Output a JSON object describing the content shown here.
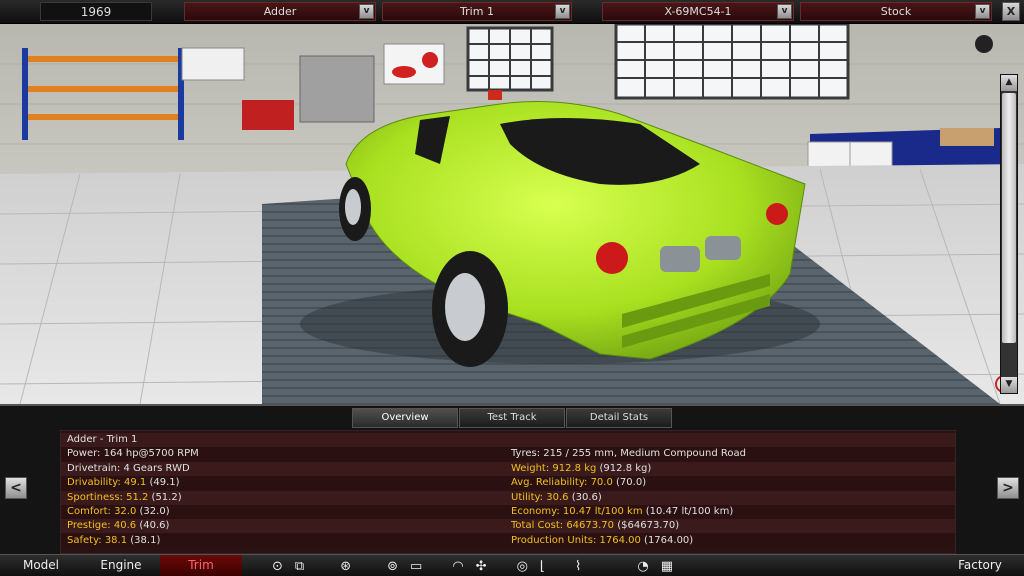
{
  "topbar": {
    "year": "1969",
    "model": "Adder",
    "trim": "Trim 1",
    "engine": "X-69MC54-1",
    "variant": "Stock",
    "dropdown_glyph": "v",
    "close_glyph": "X"
  },
  "tabs": [
    "Overview",
    "Test Track",
    "Detail Stats"
  ],
  "stats": {
    "left": [
      {
        "label": "Adder - Trim 1",
        "color": "white"
      },
      {
        "label": "Power: 164 hp@5700 RPM",
        "color": "white"
      },
      {
        "label": "Drivetrain: 4 Gears RWD",
        "color": "white"
      },
      {
        "label": "Drivability:",
        "value": " 49.1",
        "extra": " (49.1)",
        "color": "yellow"
      },
      {
        "label": "Sportiness:",
        "value": " 51.2",
        "extra": " (51.2)",
        "color": "yellow"
      },
      {
        "label": "Comfort:",
        "value": " 32.0",
        "extra": " (32.0)",
        "color": "yellow"
      },
      {
        "label": "Prestige:",
        "value": " 40.6",
        "extra": " (40.6)",
        "color": "yellow"
      },
      {
        "label": "Safety:",
        "value": " 38.1",
        "extra": " (38.1)",
        "color": "yellow"
      }
    ],
    "right": [
      {
        "label": "",
        "color": "white"
      },
      {
        "label": "Tyres: 215 / 255 mm, Medium Compound Road",
        "color": "white"
      },
      {
        "label": "Weight:",
        "value": " 912.8 kg",
        "extra": " (912.8 kg)",
        "color": "yellow"
      },
      {
        "label": "Avg. Reliability:",
        "value": " 70.0",
        "extra": " (70.0)",
        "color": "yellow"
      },
      {
        "label": "Utility:",
        "value": " 30.6",
        "extra": " (30.6)",
        "color": "yellow"
      },
      {
        "label": "Economy:",
        "value": " 10.47 lt/100 km",
        "extra": " (10.47 lt/100 km)",
        "color": "yellow"
      },
      {
        "label": "Total Cost:",
        "value": " 64673.70",
        "extra": " ($64673.70)",
        "color": "yellow"
      },
      {
        "label": "Production Units:",
        "value": " 1764.00",
        "extra": " (1764.00)",
        "color": "yellow"
      }
    ]
  },
  "side": {
    "prev": "<",
    "next": ">"
  },
  "nav": {
    "model": "Model",
    "engine": "Engine",
    "trim": "Trim",
    "factory": "Factory"
  },
  "colors": {
    "car_body": "#a8e020",
    "accent_red": "#8a1010",
    "stat_yellow": "#f0c020"
  }
}
